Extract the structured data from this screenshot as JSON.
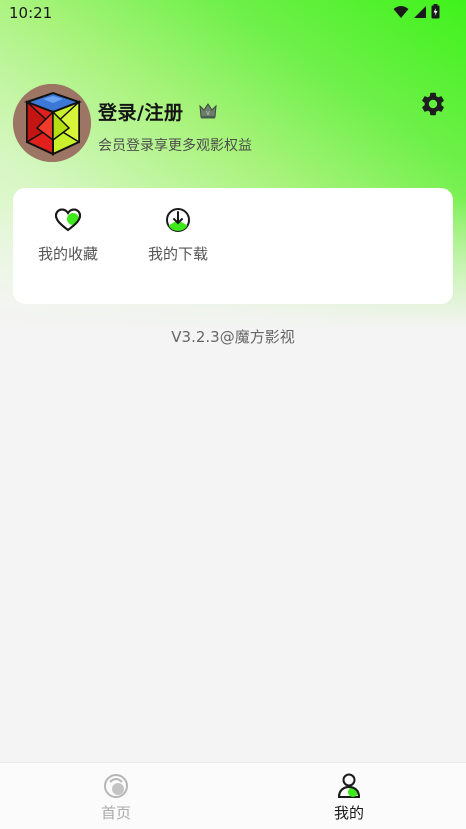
{
  "status_bar": {
    "time": "10:21",
    "icons": [
      "wifi-icon",
      "cell-signal-icon",
      "battery-icon"
    ]
  },
  "profile": {
    "avatar": "rubiks-cube-avatar",
    "login_label": "登录/注册",
    "subtitle": "会员登录享更多观影权益",
    "badge_icon": "crown-icon",
    "settings_icon": "gear-icon"
  },
  "quick_actions": [
    {
      "label": "我的收藏",
      "icon": "heart-icon"
    },
    {
      "label": "我的下载",
      "icon": "download-icon"
    }
  ],
  "version_text": "V3.2.3@魔方影视",
  "tabbar": {
    "tabs": [
      {
        "label": "首页",
        "icon": "home-icon",
        "active": false
      },
      {
        "label": "我的",
        "icon": "profile-icon",
        "active": true
      }
    ]
  },
  "colors": {
    "accent_green": "#3ff21b",
    "background": "#f4f4f4",
    "card": "#ffffff"
  }
}
